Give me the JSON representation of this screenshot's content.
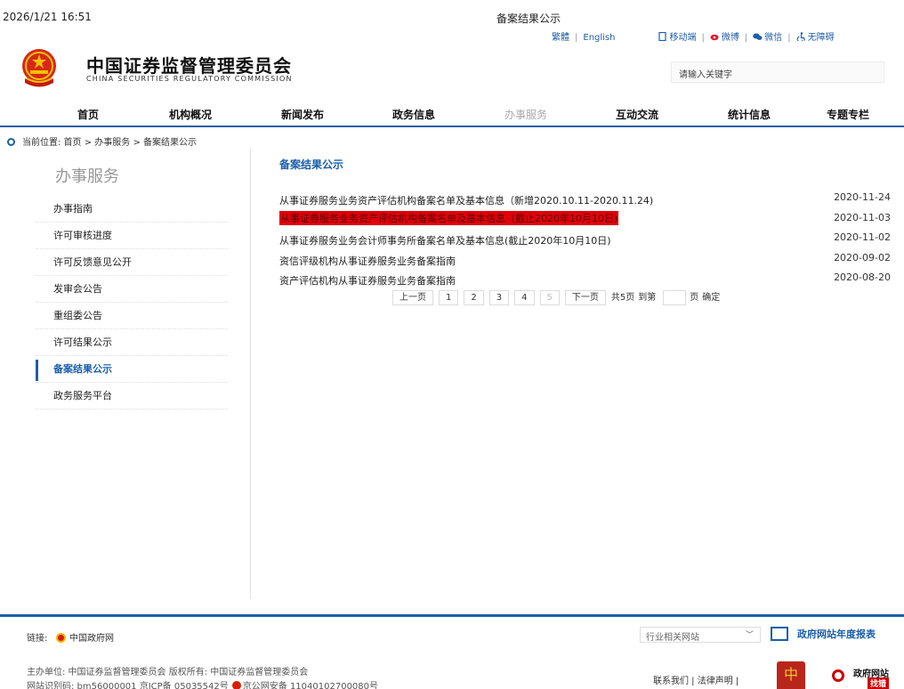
{
  "print_header": {
    "datetime": "2026/1/21 16:51",
    "page_title": "备案结果公示"
  },
  "top_links": {
    "traditional": "繁體",
    "english": "English",
    "mobile": "移动端",
    "weibo": "微博",
    "wechat": "微信",
    "accessibility": "无障碍"
  },
  "brand": {
    "cn_name": "中国证券监督管理委员会",
    "en_name": "CHINA SECURITIES REGULATORY COMMISSION"
  },
  "search": {
    "placeholder": "请输入关键字"
  },
  "nav": [
    {
      "label": "首页"
    },
    {
      "label": "机构概况"
    },
    {
      "label": "新闻发布"
    },
    {
      "label": "政务信息"
    },
    {
      "label": "办事服务"
    },
    {
      "label": "互动交流"
    },
    {
      "label": "统计信息"
    },
    {
      "label": "专题专栏"
    }
  ],
  "breadcrumb": {
    "text": "当前位置:  首页 > 办事服务 > 备案结果公示"
  },
  "sidebar": {
    "title": "办事服务",
    "items": [
      {
        "label": "办事指南"
      },
      {
        "label": "许可审核进度"
      },
      {
        "label": "许可反馈意见公开"
      },
      {
        "label": "发审会公告"
      },
      {
        "label": "重组委公告"
      },
      {
        "label": "许可结果公示"
      },
      {
        "label": "备案结果公示"
      },
      {
        "label": "政务服务平台"
      }
    ]
  },
  "content": {
    "title": "备案结果公示",
    "rows": [
      {
        "title": "从事证券服务业务资产评估机构备案名单及基本信息（新增2020.10.11-2020.11.24)",
        "date": "2020-11-24"
      },
      {
        "title": "从事证券服务业务资产评估机构备案名单及基本信息（截止2020年10月10日)",
        "date": "2020-11-03"
      },
      {
        "title": "从事证券服务业务会计师事务所备案名单及基本信息(截止2020年10月10日)",
        "date": "2020-11-02"
      },
      {
        "title": "资信评级机构从事证券服务业务备案指南",
        "date": "2020-09-02"
      },
      {
        "title": "资产评估机构从事证券服务业务备案指南",
        "date": "2020-08-20"
      }
    ]
  },
  "pager": {
    "prev": "上一页",
    "pages": [
      "1",
      "2",
      "3",
      "4",
      "5"
    ],
    "next": "下一页",
    "total": "共5页",
    "goto": "到第",
    "page_unit": "页",
    "confirm": "确定"
  },
  "footer": {
    "links_label": "链接:",
    "gov_link": "中国政府网",
    "select_value": "行业相关网站",
    "annual_report": "政府网站年度报表",
    "sponsor": "主办单位:  中国证券监督管理委员会      版权所有:  中国证券监督管理委员会",
    "site_code": "网站识别码:  bm56000001   京ICP备 05035542号",
    "police_record": "京公网安备 11040102700080号",
    "contact": "联系我们 | 法律声明 |",
    "badge_right_top": "政府网站",
    "badge_right_bottom": "找错",
    "badge_left_glyph": "中"
  },
  "colors": {
    "brand_blue": "#1a5fa8",
    "highlight_red": "#e0000a"
  }
}
